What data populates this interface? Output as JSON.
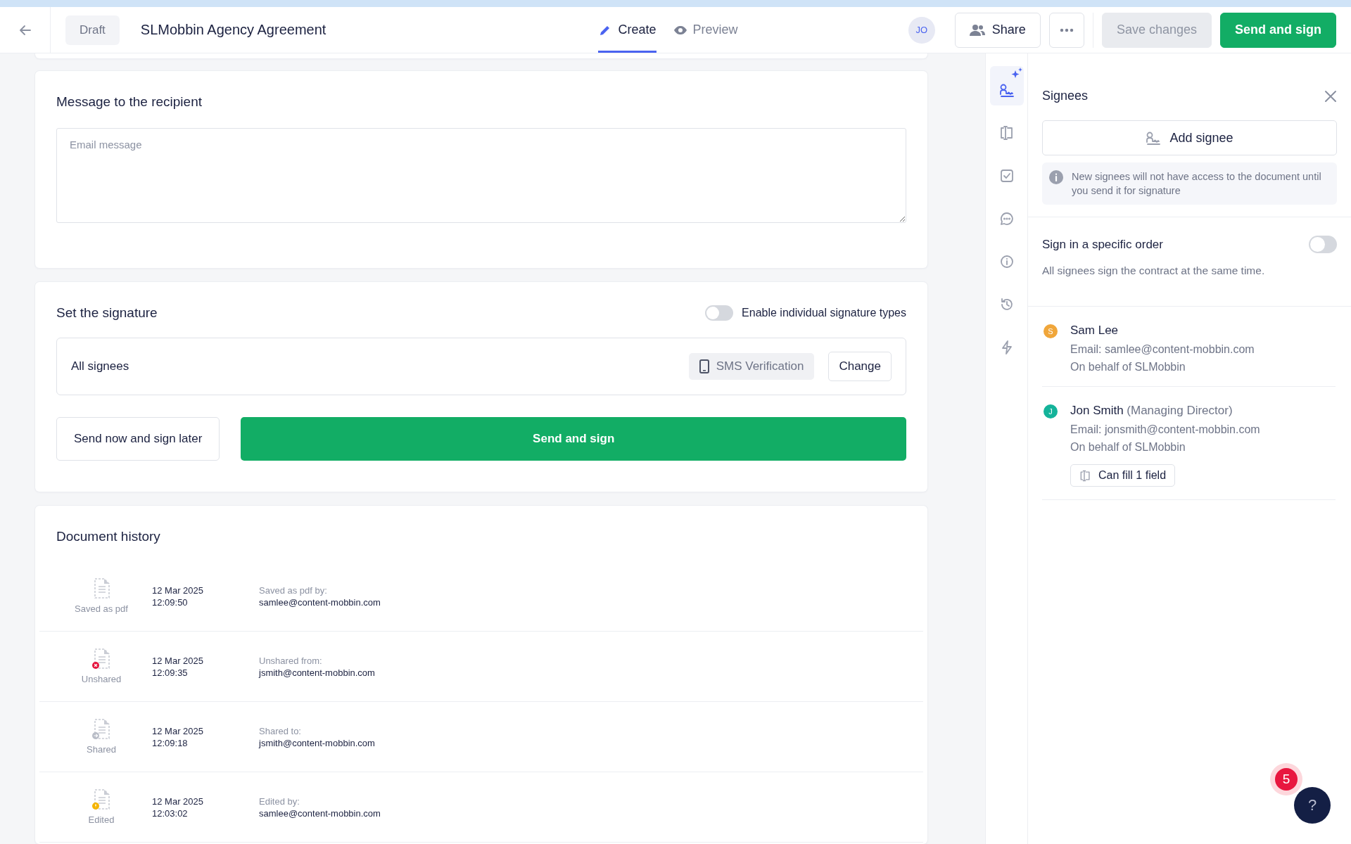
{
  "header": {
    "status": "Draft",
    "title": "SLMobbin Agency Agreement",
    "tabs": [
      {
        "kind": "create",
        "label": "Create",
        "selected": true
      },
      {
        "kind": "preview",
        "label": "Preview",
        "selected": false
      }
    ],
    "avatar": "JO",
    "share": "Share",
    "save": {
      "label": "Save changes",
      "disabled": true
    },
    "send": "Send and sign"
  },
  "message": {
    "title": "Message to the recipient",
    "placeholder": "Email message"
  },
  "signature": {
    "title": "Set the signature",
    "toggle": {
      "label": "Enable individual signature types",
      "on": false
    },
    "row": {
      "label": "All signees",
      "method": "SMS Verification",
      "change": "Change"
    },
    "secondary": "Send now and sign later",
    "primary": "Send and sign"
  },
  "history": {
    "title": "Document history",
    "events": [
      {
        "kind": "saved",
        "label": "Saved as pdf",
        "date": "12 Mar 2025",
        "time": "12:09:50",
        "action": "Saved as pdf by:",
        "email": "samlee@content-mobbin.com"
      },
      {
        "kind": "unshared",
        "label": "Unshared",
        "date": "12 Mar 2025",
        "time": "12:09:35",
        "action": "Unshared from:",
        "email": "jsmith@content-mobbin.com"
      },
      {
        "kind": "shared",
        "label": "Shared",
        "date": "12 Mar 2025",
        "time": "12:09:18",
        "action": "Shared to:",
        "email": "jsmith@content-mobbin.com"
      },
      {
        "kind": "edited",
        "label": "Edited",
        "date": "12 Mar 2025",
        "time": "12:03:02",
        "action": "Edited by:",
        "email": "samlee@content-mobbin.com"
      }
    ]
  },
  "rail": [
    {
      "kind": "signee",
      "selected": true
    },
    {
      "kind": "field",
      "selected": false
    },
    {
      "kind": "checkbox",
      "selected": false
    },
    {
      "kind": "comment",
      "selected": false
    },
    {
      "kind": "info",
      "selected": false
    },
    {
      "kind": "history",
      "selected": false
    },
    {
      "kind": "bolt",
      "selected": false
    }
  ],
  "panel": {
    "title": "Signees",
    "add": "Add signee",
    "note": "New signees will not have access to the document until you send it for signature",
    "order": {
      "label": "Sign in a specific order",
      "on": false,
      "hint": "All signees sign the contract at the same time."
    },
    "signees": [
      {
        "initial": "S",
        "color": "#f0a63a",
        "name": "Sam Lee",
        "email": "Email: samlee@content-mobbin.com",
        "behalf": "On behalf of SLMobbin"
      },
      {
        "initial": "J",
        "color": "#14b39a",
        "name": "Jon Smith",
        "role": "(Managing Director)",
        "email": "Email: jonsmith@content-mobbin.com",
        "behalf": "On behalf of SLMobbin",
        "fields": "Can fill 1 field"
      }
    ]
  },
  "help": {
    "badge": "5",
    "label": "?"
  }
}
